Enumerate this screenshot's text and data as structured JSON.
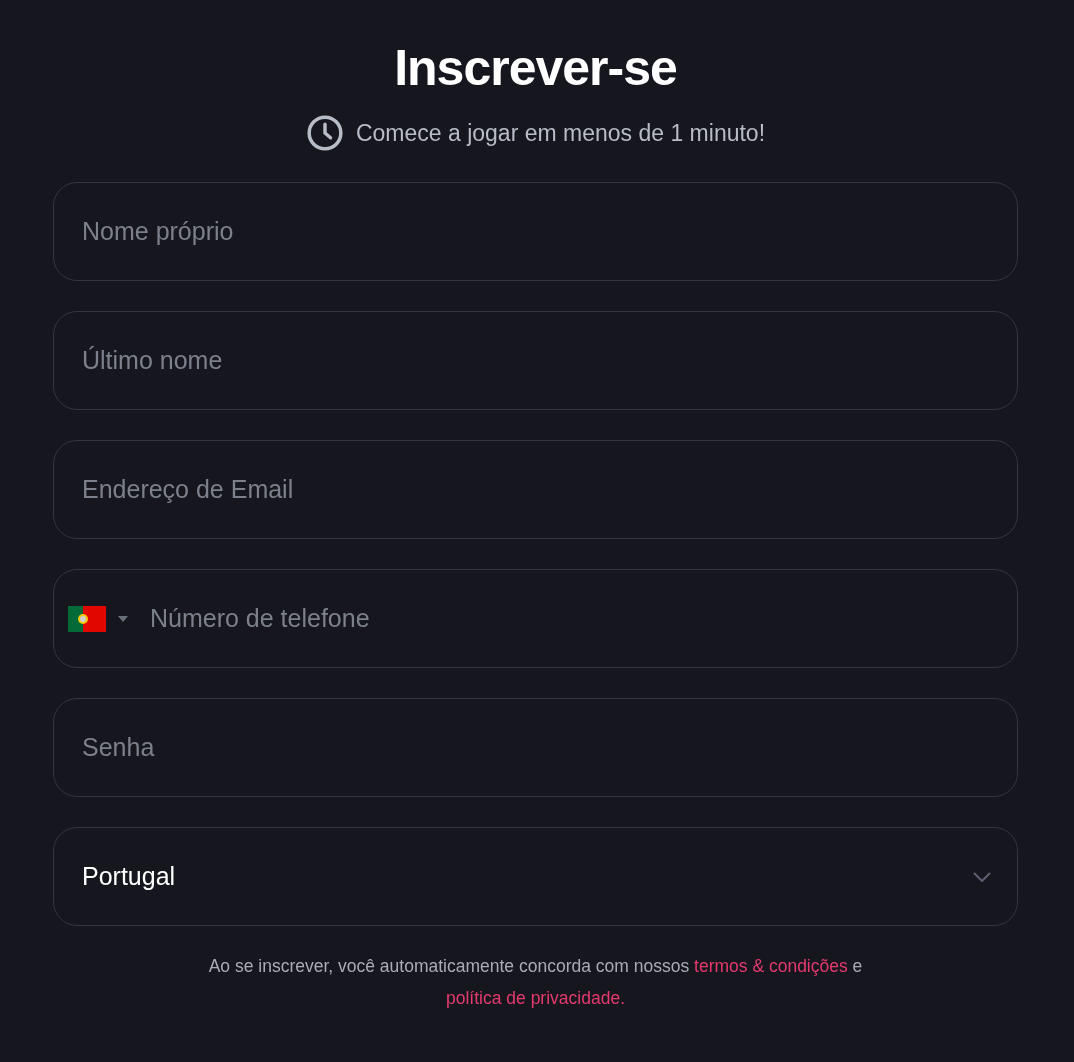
{
  "title": "Inscrever-se",
  "subtitle": "Comece a jogar em menos de 1 minuto!",
  "fields": [
    {
      "kind": "text",
      "placeholder": "Nome próprio"
    },
    {
      "kind": "text",
      "placeholder": "Último nome"
    },
    {
      "kind": "text",
      "placeholder": "Endereço de Email"
    },
    {
      "kind": "phone",
      "placeholder": "Número de telefone"
    },
    {
      "kind": "password",
      "placeholder": "Senha"
    },
    {
      "kind": "select",
      "value": "Portugal"
    }
  ],
  "consent": {
    "text": "Ao se inscrever, você automaticamente concorda com nossos",
    "terms_link": "termos & condições",
    "joiner": "e",
    "privacy_link": "política de privacidade."
  }
}
